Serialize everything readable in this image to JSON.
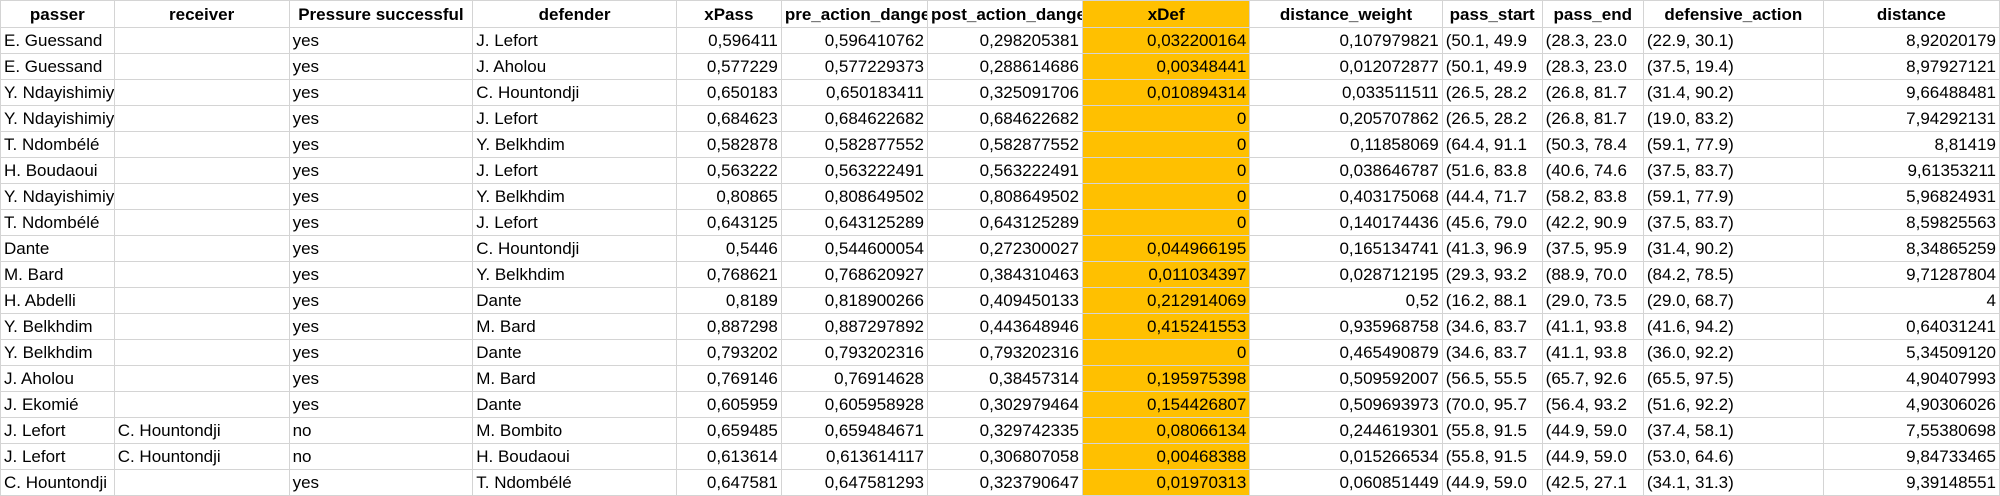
{
  "colors": {
    "highlight": "#ffc000",
    "grid": "#d4d4d4"
  },
  "headers": [
    "passer",
    "receiver",
    "Pressure successful",
    "defender",
    "xPass",
    "pre_action_danger",
    "post_action_danger",
    "xDef",
    "distance_weight",
    "pass_start",
    "pass_end",
    "defensive_action",
    "distance"
  ],
  "rows": [
    [
      "E. Guessand",
      "",
      "yes",
      "J. Lefort",
      "0,596411",
      "0,596410762",
      "0,298205381",
      "0,032200164",
      "0,107979821",
      "(50.1, 49.9",
      "(28.3, 23.0",
      "(22.9, 30.1)",
      "8,92020179"
    ],
    [
      "E. Guessand",
      "",
      "yes",
      "J. Aholou",
      "0,577229",
      "0,577229373",
      "0,288614686",
      "0,00348441",
      "0,012072877",
      "(50.1, 49.9",
      "(28.3, 23.0",
      "(37.5, 19.4)",
      "8,97927121"
    ],
    [
      "Y. Ndayishimiye",
      "",
      "yes",
      "C. Hountondji",
      "0,650183",
      "0,650183411",
      "0,325091706",
      "0,010894314",
      "0,033511511",
      "(26.5, 28.2",
      "(26.8, 81.7",
      "(31.4, 90.2)",
      "9,66488481"
    ],
    [
      "Y. Ndayishimiye",
      "",
      "yes",
      "J. Lefort",
      "0,684623",
      "0,684622682",
      "0,684622682",
      "0",
      "0,205707862",
      "(26.5, 28.2",
      "(26.8, 81.7",
      "(19.0, 83.2)",
      "7,94292131"
    ],
    [
      "T. Ndombélé",
      "",
      "yes",
      "Y. Belkhdim",
      "0,582878",
      "0,582877552",
      "0,582877552",
      "0",
      "0,11858069",
      "(64.4, 91.1",
      "(50.3, 78.4",
      "(59.1, 77.9)",
      "8,81419"
    ],
    [
      "H. Boudaoui",
      "",
      "yes",
      "J. Lefort",
      "0,563222",
      "0,563222491",
      "0,563222491",
      "0",
      "0,038646787",
      "(51.6, 83.8",
      "(40.6, 74.6",
      "(37.5, 83.7)",
      "9,61353211"
    ],
    [
      "Y. Ndayishimiye",
      "",
      "yes",
      "Y. Belkhdim",
      "0,80865",
      "0,808649502",
      "0,808649502",
      "0",
      "0,403175068",
      "(44.4, 71.7",
      "(58.2, 83.8",
      "(59.1, 77.9)",
      "5,96824931"
    ],
    [
      "T. Ndombélé",
      "",
      "yes",
      "J. Lefort",
      "0,643125",
      "0,643125289",
      "0,643125289",
      "0",
      "0,140174436",
      "(45.6, 79.0",
      "(42.2, 90.9",
      "(37.5, 83.7)",
      "8,59825563"
    ],
    [
      "Dante",
      "",
      "yes",
      "C. Hountondji",
      "0,5446",
      "0,544600054",
      "0,272300027",
      "0,044966195",
      "0,165134741",
      "(41.3, 96.9",
      "(37.5, 95.9",
      "(31.4, 90.2)",
      "8,34865259"
    ],
    [
      "M. Bard",
      "",
      "yes",
      "Y. Belkhdim",
      "0,768621",
      "0,768620927",
      "0,384310463",
      "0,011034397",
      "0,028712195",
      "(29.3, 93.2",
      "(88.9, 70.0",
      "(84.2, 78.5)",
      "9,71287804"
    ],
    [
      "H. Abdelli",
      "",
      "yes",
      "Dante",
      "0,8189",
      "0,818900266",
      "0,409450133",
      "0,212914069",
      "0,52",
      "(16.2, 88.1",
      "(29.0, 73.5",
      "(29.0, 68.7)",
      "4"
    ],
    [
      "Y. Belkhdim",
      "",
      "yes",
      "M. Bard",
      "0,887298",
      "0,887297892",
      "0,443648946",
      "0,415241553",
      "0,935968758",
      "(34.6, 83.7",
      "(41.1, 93.8",
      "(41.6, 94.2)",
      "0,64031241"
    ],
    [
      "Y. Belkhdim",
      "",
      "yes",
      "Dante",
      "0,793202",
      "0,793202316",
      "0,793202316",
      "0",
      "0,465490879",
      "(34.6, 83.7",
      "(41.1, 93.8",
      "(36.0, 92.2)",
      "5,34509120"
    ],
    [
      "J. Aholou",
      "",
      "yes",
      "M. Bard",
      "0,769146",
      "0,76914628",
      "0,38457314",
      "0,195975398",
      "0,509592007",
      "(56.5, 55.5",
      "(65.7, 92.6",
      "(65.5, 97.5)",
      "4,90407993"
    ],
    [
      "J. Ekomié",
      "",
      "yes",
      "Dante",
      "0,605959",
      "0,605958928",
      "0,302979464",
      "0,154426807",
      "0,509693973",
      "(70.0, 95.7",
      "(56.4, 93.2",
      "(51.6, 92.2)",
      "4,90306026"
    ],
    [
      "J. Lefort",
      "C. Hountondji",
      "no",
      "M. Bombito",
      "0,659485",
      "0,659484671",
      "0,329742335",
      "0,08066134",
      "0,244619301",
      "(55.8, 91.5",
      "(44.9, 59.0",
      "(37.4, 58.1)",
      "7,55380698"
    ],
    [
      "J. Lefort",
      "C. Hountondji",
      "no",
      "H. Boudaoui",
      "0,613614",
      "0,613614117",
      "0,306807058",
      "0,00468388",
      "0,015266534",
      "(55.8, 91.5",
      "(44.9, 59.0",
      "(53.0, 64.6)",
      "9,84733465"
    ],
    [
      "C. Hountondji",
      "",
      "yes",
      "T. Ndombélé",
      "0,647581",
      "0,647581293",
      "0,323790647",
      "0,01970313",
      "0,060851449",
      "(44.9, 59.0",
      "(42.5, 27.1",
      "(34.1, 31.3)",
      "9,39148551"
    ]
  ]
}
